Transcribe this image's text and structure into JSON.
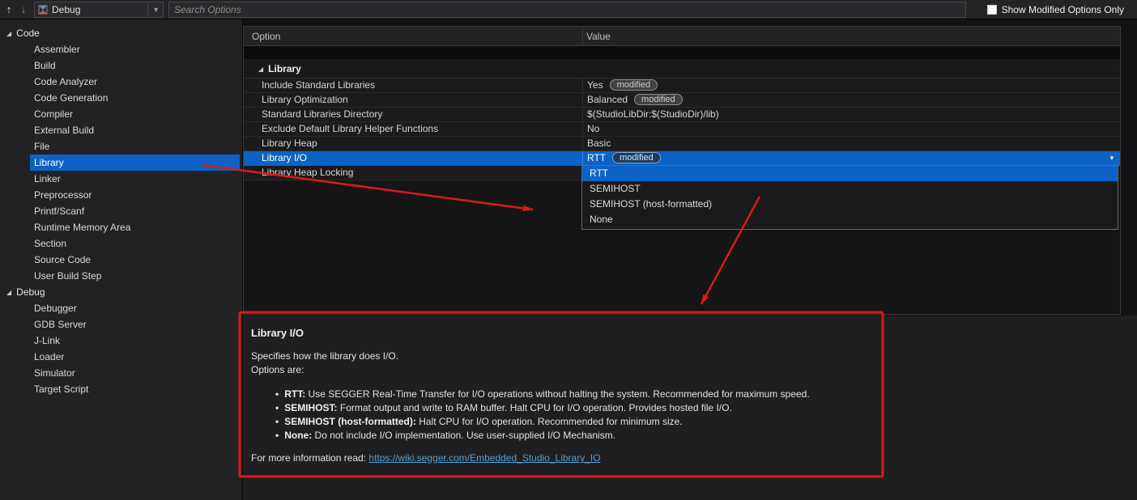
{
  "toolbar": {
    "config_label": "Debug",
    "search_placeholder": "Search Options",
    "show_modified_label": "Show Modified Options Only"
  },
  "sidebar": {
    "groups": [
      {
        "label": "Code",
        "items": [
          "Assembler",
          "Build",
          "Code Analyzer",
          "Code Generation",
          "Compiler",
          "External Build",
          "File",
          "Library",
          "Linker",
          "Preprocessor",
          "Printf/Scanf",
          "Runtime Memory Area",
          "Section",
          "Source Code",
          "User Build Step"
        ],
        "selected": "Library"
      },
      {
        "label": "Debug",
        "items": [
          "Debugger",
          "GDB Server",
          "J-Link",
          "Loader",
          "Simulator",
          "Target Script"
        ]
      }
    ]
  },
  "options_table": {
    "columns": [
      "Option",
      "Value"
    ],
    "group_label": "Library",
    "badge_label": "modified",
    "rows": [
      {
        "option": "Include Standard Libraries",
        "value": "Yes",
        "modified": true
      },
      {
        "option": "Library Optimization",
        "value": "Balanced",
        "modified": true
      },
      {
        "option": "Standard Libraries Directory",
        "value": "$(StudioLibDir:$(StudioDir)/lib)",
        "modified": false
      },
      {
        "option": "Exclude Default Library Helper Functions",
        "value": "No",
        "modified": false
      },
      {
        "option": "Library Heap",
        "value": "Basic",
        "modified": false
      },
      {
        "option": "Library I/O",
        "value": "RTT",
        "modified": true,
        "selected": true
      },
      {
        "option": "Library Heap Locking",
        "value": "",
        "modified": false
      }
    ]
  },
  "dropdown": {
    "selected": "RTT",
    "items": [
      "RTT",
      "SEMIHOST",
      "SEMIHOST (host-formatted)",
      "None"
    ]
  },
  "description": {
    "title": "Library I/O",
    "line1": "Specifies how the library does I/O.",
    "line2": "Options are:",
    "bullets": [
      {
        "term": "RTT:",
        "text": " Use SEGGER Real-Time Transfer for I/O operations without halting the system. Recommended for maximum speed."
      },
      {
        "term": "SEMIHOST:",
        "text": " Format output and write to RAM buffer. Halt CPU for I/O operation. Provides hosted file I/O."
      },
      {
        "term": "SEMIHOST (host-formatted):",
        "text": " Halt CPU for I/O operation. Recommended for minimum size."
      },
      {
        "term": "None:",
        "text": " Do not include I/O implementation. Use user-supplied I/O Mechanism."
      }
    ],
    "more_info_label": "For more information read: ",
    "link": "https://wiki.segger.com/Embedded_Studio_Library_IO"
  },
  "colors": {
    "selection_blue": "#0d63c5",
    "annotation_red": "#dc1a1a",
    "link_blue": "#4f9fd8"
  }
}
